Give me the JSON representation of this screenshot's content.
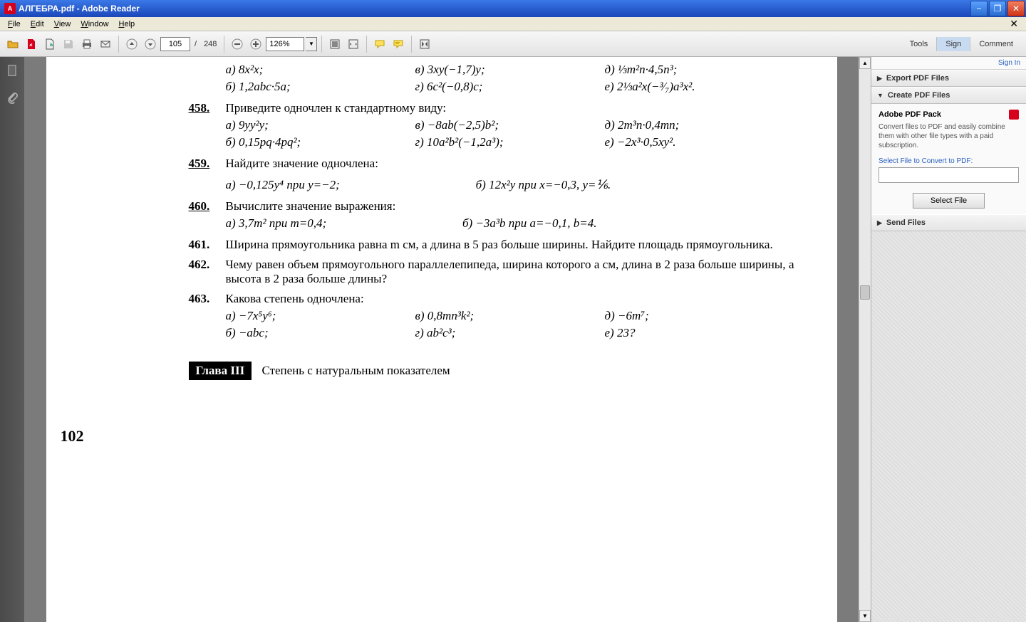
{
  "window": {
    "title": "АЛГЕБРА.pdf - Adobe Reader"
  },
  "menu": {
    "file": "File",
    "edit": "Edit",
    "view": "View",
    "window": "Window",
    "help": "Help"
  },
  "toolbar": {
    "page_current": "105",
    "page_sep": "/",
    "page_total": "248",
    "zoom": "126%",
    "right": {
      "tools": "Tools",
      "sign": "Sign",
      "comment": "Comment"
    }
  },
  "right_panel": {
    "sign_in": "Sign In",
    "export_hdr": "Export PDF Files",
    "create_hdr": "Create PDF Files",
    "pack_title": "Adobe PDF Pack",
    "pack_desc": "Convert files to PDF and easily combine them with other file types with a paid subscription.",
    "select_label": "Select File to Convert to PDF:",
    "select_btn": "Select File",
    "send_hdr": "Send Files"
  },
  "document": {
    "page_number": "102",
    "chapter_label": "Глава III",
    "chapter_title": "Степень с натуральным показателем",
    "top_row": {
      "a": "а) 8x²x;",
      "v": "в) 3xy(−1,7)y;",
      "d": "д) ⅓m²n·4,5n³;"
    },
    "top_row2": {
      "b": "б) 1,2abc·5a;",
      "g": "г) 6c²(−0,8)c;",
      "e": "е) 2⅓a²x(−³⁄₇)a³x²."
    },
    "p458": {
      "num": "458.",
      "title": "Приведите одночлен к стандартному виду:",
      "a": "а) 9yy²y;",
      "v": "в) −8ab(−2,5)b²;",
      "d": "д) 2m³n·0,4mn;",
      "b": "б) 0,15pq·4pq²;",
      "g": "г) 10a²b²(−1,2a³);",
      "e": "е) −2x³·0,5xy²."
    },
    "p459": {
      "num": "459.",
      "title": "Найдите значение одночлена:",
      "a": "а) −0,125y⁴ при y=−2;",
      "b": "б) 12x²y при x=−0,3, y=⅙."
    },
    "p460": {
      "num": "460.",
      "title": "Вычислите значение выражения:",
      "a": "а) 3,7m² при m=0,4;",
      "b": "б) −3a³b при a=−0,1, b=4."
    },
    "p461": {
      "num": "461.",
      "text": "Ширина прямоугольника равна m см, а длина в 5 раз больше ширины. Найдите площадь прямоугольника."
    },
    "p462": {
      "num": "462.",
      "text": "Чему равен объем прямоугольного параллелепипеда, ширина которого a см, длина в 2 раза больше ширины, а высота в 2 раза больше длины?"
    },
    "p463": {
      "num": "463.",
      "title": "Какова степень одночлена:",
      "a": "а) −7x⁵y⁶;",
      "v": "в) 0,8mn³k²;",
      "d": "д) −6m⁷;",
      "b": "б) −abc;",
      "g": "г) ab²c³;",
      "e": "е) 23?"
    }
  }
}
